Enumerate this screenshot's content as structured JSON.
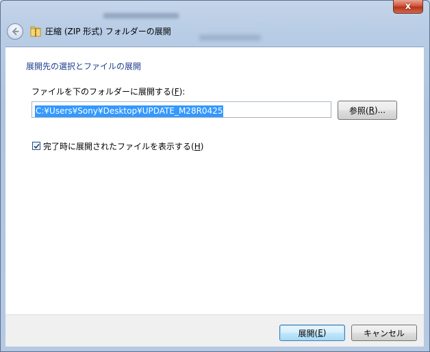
{
  "window": {
    "title": "圧縮 (ZIP 形式) フォルダーの展開",
    "close_glyph": "x"
  },
  "main": {
    "instruction": "展開先の選択とファイルの展開",
    "destination": {
      "label": "ファイルを下のフォルダーに展開する(",
      "accesskey": "F",
      "label_end": "):",
      "value": "C:¥Users¥Sony¥Desktop¥UPDATE_M28R0425"
    },
    "browse": {
      "label": "参照(",
      "accesskey": "R",
      "label_end": ")..."
    },
    "show_files": {
      "checked": true,
      "label": "完了時に展開されたファイルを表示する(",
      "accesskey": "H",
      "label_end": ")"
    }
  },
  "footer": {
    "extract": {
      "label": "展開(",
      "accesskey": "E",
      "label_end": ")"
    },
    "cancel_label": "キャンセル"
  },
  "icons": {
    "back": "back-arrow-icon",
    "folder": "zip-folder-icon",
    "check": "checkmark-icon",
    "close": "close-icon"
  },
  "colors": {
    "instruction": "#1c3c8e",
    "selection": "#3399ff",
    "close": "#c7452a"
  }
}
